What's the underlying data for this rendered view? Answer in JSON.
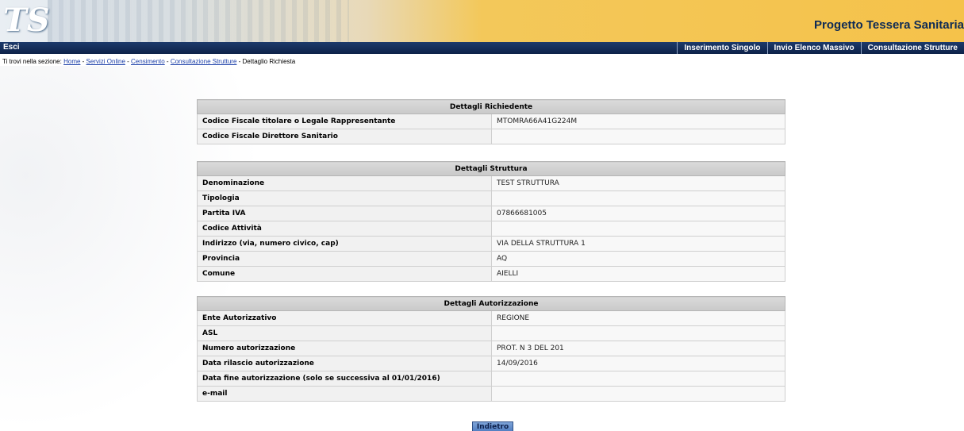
{
  "header": {
    "logo_text": "TS",
    "site_title": "Progetto Tessera Sanitaria"
  },
  "navbar": {
    "esci": "Esci",
    "menu": [
      "Inserimento Singolo",
      "Invio Elenco Massivo",
      "Consultazione Strutture"
    ]
  },
  "breadcrumb": {
    "prefix": "Ti trovi nella sezione:",
    "links": [
      "Home",
      "Servizi Online",
      "Censimento",
      "Consultazione Strutture"
    ],
    "separator": " - ",
    "current": "Dettaglio Richiesta"
  },
  "richiedente": {
    "title": "Dettagli Richiedente",
    "rows": [
      {
        "label": "Codice Fiscale titolare o Legale Rappresentante",
        "value": "MTOMRA66A41G224M"
      },
      {
        "label": "Codice Fiscale Direttore Sanitario",
        "value": ""
      }
    ]
  },
  "struttura": {
    "title": "Dettagli Struttura",
    "rows": [
      {
        "label": "Denominazione",
        "value": "TEST STRUTTURA"
      },
      {
        "label": "Tipologia",
        "value": ""
      },
      {
        "label": "Partita IVA",
        "value": "07866681005"
      },
      {
        "label": "Codice Attività",
        "value": ""
      },
      {
        "label": "Indirizzo (via, numero civico, cap)",
        "value": "VIA DELLA STRUTTURA 1"
      },
      {
        "label": "Provincia",
        "value": "AQ"
      },
      {
        "label": "Comune",
        "value": "AIELLI"
      }
    ]
  },
  "autorizzazione": {
    "title": "Dettagli Autorizzazione",
    "rows": [
      {
        "label": "Ente Autorizzativo",
        "value": "REGIONE"
      },
      {
        "label": "ASL",
        "value": ""
      },
      {
        "label": "Numero autorizzazione",
        "value": "PROT. N 3 DEL 201"
      },
      {
        "label": "Data rilascio autorizzazione",
        "value": "14/09/2016"
      },
      {
        "label": "Data fine autorizzazione (solo se successiva al 01/01/2016)",
        "value": ""
      },
      {
        "label": "e-mail",
        "value": ""
      }
    ]
  },
  "actions": {
    "back_label": "Indietro"
  },
  "colors": {
    "nav_bg": "#0e2249",
    "title_color": "#0d2a55",
    "header_gold": "#f5c24a",
    "link_color": "#1c3fa8",
    "button_bg": "#4f7cc0"
  }
}
